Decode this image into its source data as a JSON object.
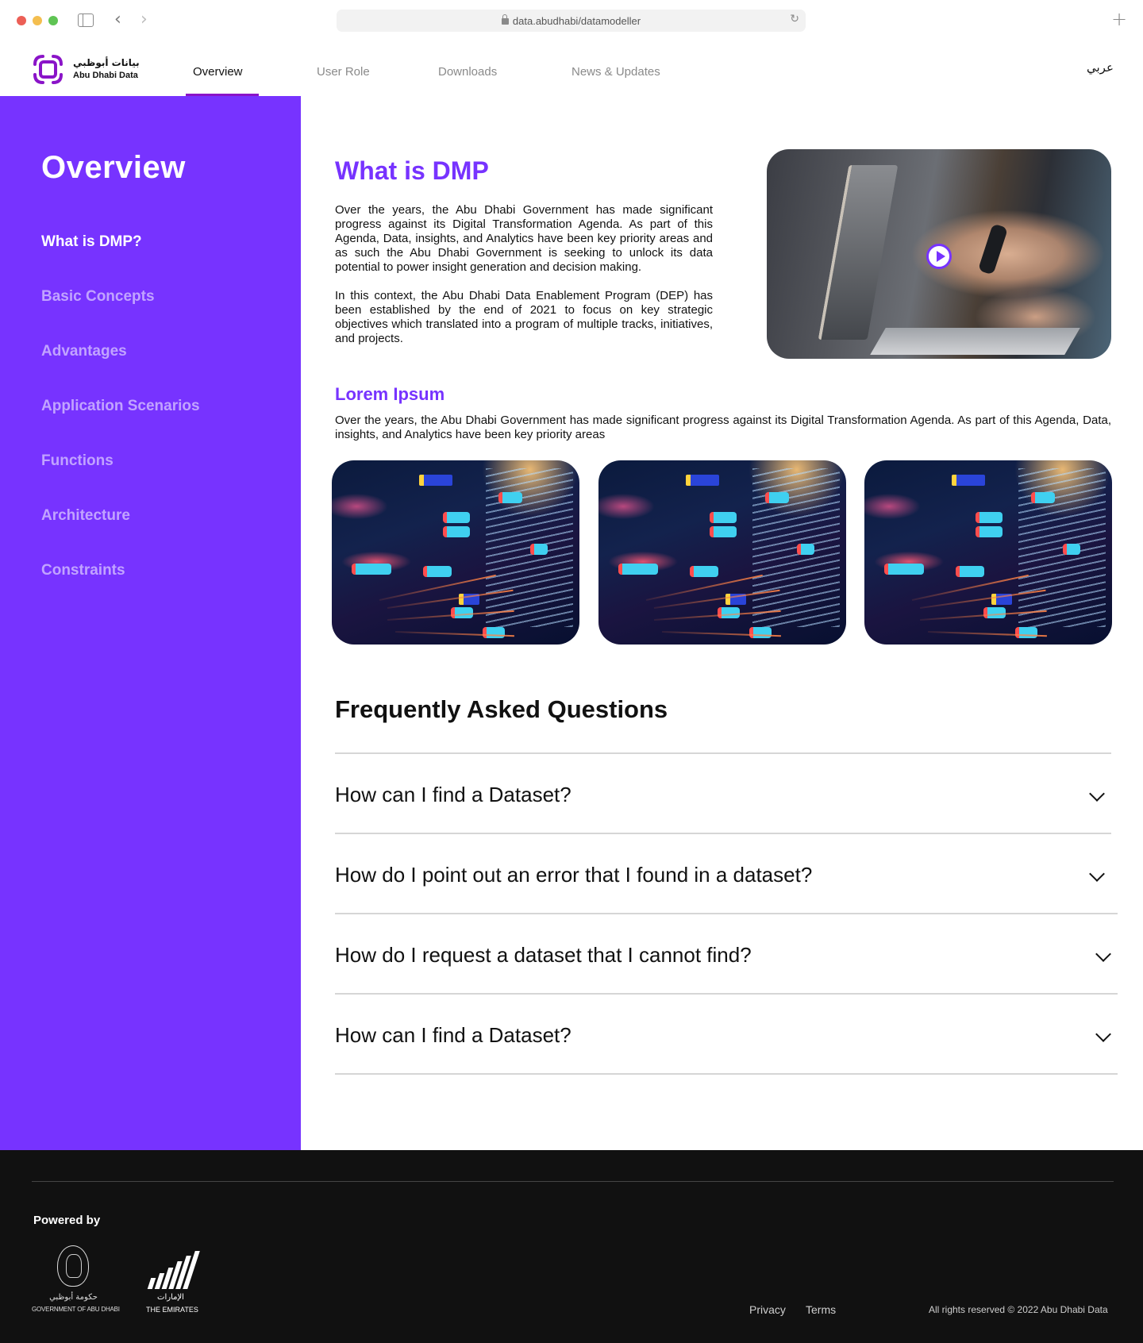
{
  "browser": {
    "url": "data.abudhabi/datamodeller"
  },
  "header": {
    "logo_ar": "بيانات أبوظبي",
    "logo_en": "Abu Dhabi Data",
    "nav": [
      {
        "label": "Overview",
        "active": true
      },
      {
        "label": "User Role",
        "active": false
      },
      {
        "label": "Downloads",
        "active": false
      },
      {
        "label": "News & Updates",
        "active": false
      }
    ],
    "lang_toggle": "عربي",
    "accent_color": "#8a14c8"
  },
  "sidebar": {
    "title": "Overview",
    "bg_color": "#7733ff",
    "items": [
      {
        "label": "What is DMP?",
        "active": true
      },
      {
        "label": "Basic Concepts",
        "active": false
      },
      {
        "label": "Advantages",
        "active": false
      },
      {
        "label": "Application Scenarios",
        "active": false
      },
      {
        "label": "Functions",
        "active": false
      },
      {
        "label": "Architecture",
        "active": false
      },
      {
        "label": "Constraints",
        "active": false
      }
    ]
  },
  "main": {
    "dmp_heading": "What is DMP",
    "dmp_paragraphs": [
      "Over the years, the Abu Dhabi Government has made significant progress against its Digital Transformation Agenda. As part of this Agenda, Data, insights, and Analytics have been key priority areas and as such the Abu Dhabi Government is seeking to unlock its data potential to power insight generation and decision making.",
      "In this context, the Abu Dhabi Data Enablement Program (DEP) has been established by the end of 2021 to focus on key strategic objectives which translated into a program of multiple tracks, initiatives, and projects."
    ],
    "video": {
      "alt": "Hands pointing at a laptop screen",
      "play_icon": "play-icon"
    },
    "lorem_heading": "Lorem Ipsum",
    "lorem_paragraph": "Over the years, the Abu Dhabi Government has made significant progress against its Digital Transformation Agenda. As part of this Agenda, Data, insights, and Analytics have been key priority areas",
    "thumbnails": [
      {
        "alt": "Code and data flow node graph"
      },
      {
        "alt": "Code and data flow node graph"
      },
      {
        "alt": "Code and data flow node graph"
      }
    ],
    "faq_title": "Frequently Asked Questions",
    "faqs": [
      {
        "question": "How can I find a Dataset?"
      },
      {
        "question": "How do I point out an error that I found in a dataset?"
      },
      {
        "question": "How do I request a dataset that I cannot find?"
      },
      {
        "question": "How can I find a Dataset?"
      }
    ]
  },
  "footer": {
    "powered_by": "Powered by",
    "gov_logo_ar": "حكومة أبوظبي",
    "gov_logo_en": "GOVERNMENT OF ABU DHABI",
    "uae_logo_ar": "الإمارات",
    "uae_logo_en": "THE EMIRATES",
    "links": [
      "Privacy",
      "Terms"
    ],
    "copyright": "All rights reserved © 2022 Abu Dhabi Data"
  }
}
